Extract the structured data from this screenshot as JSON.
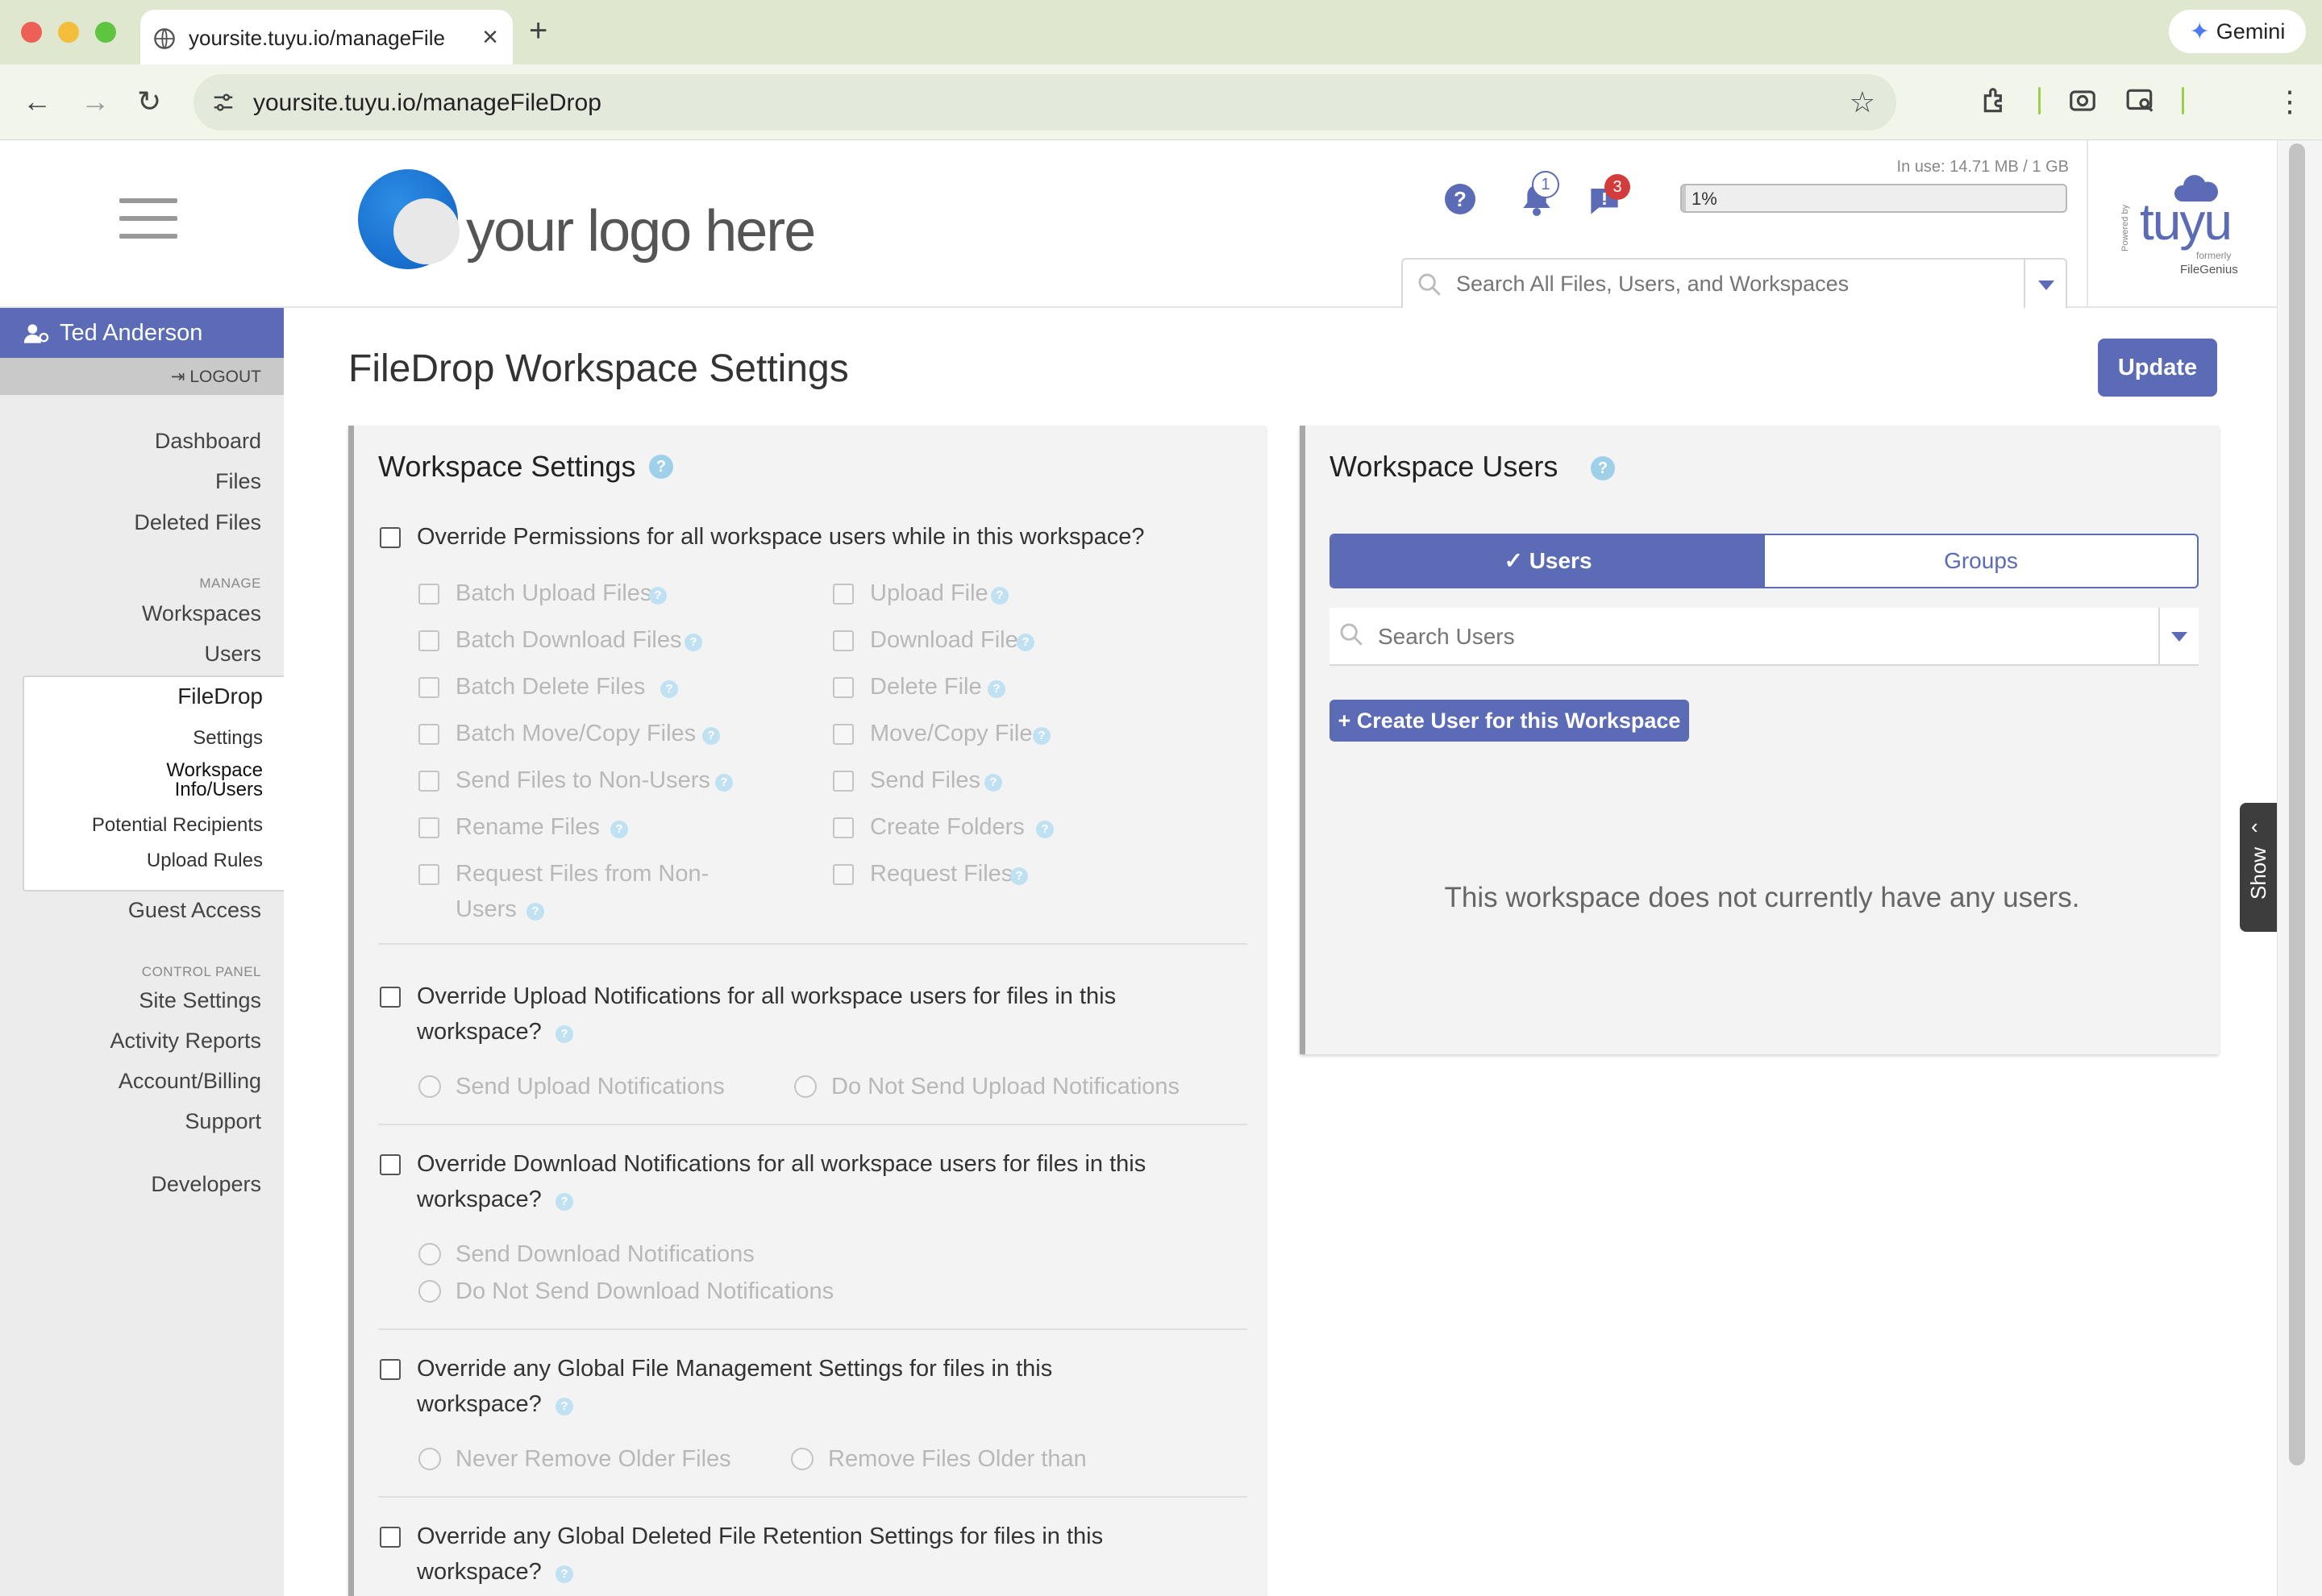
{
  "browser": {
    "tab_title": "yoursite.tuyu.io/manageFileDrop",
    "tab_close": "×",
    "new_tab": "+",
    "url": "yoursite.tuyu.io/manageFileDrop",
    "gemini_label": "Gemini",
    "back": "←",
    "forward": "→",
    "reload": "↻",
    "star": "☆",
    "menu": "⋮"
  },
  "header": {
    "logo_text": "your logo here",
    "help_badge": "?",
    "notifications_count": "1",
    "messages_count": "3",
    "usage_text": "In use: 14.71 MB / 1 GB",
    "usage_percent_label": "1%",
    "usage_fraction": 0.01,
    "search_placeholder": "Search All Files, Users, and Workspaces",
    "brand_powered": "Powered by",
    "brand_name": "tuyu",
    "brand_formerly": "formerly",
    "brand_former_name": "FileGenius"
  },
  "sidebar": {
    "user_name": "Ted Anderson",
    "logout": "LOGOUT",
    "items_top": [
      "Dashboard",
      "Files",
      "Deleted Files"
    ],
    "manage_label": "MANAGE",
    "manage_items": [
      "Workspaces",
      "Users"
    ],
    "filedrop": {
      "title": "FileDrop",
      "settings": "Settings",
      "workspace_info_1": "Workspace",
      "workspace_info_2": "Info/Users",
      "potential_recipients": "Potential Recipients",
      "upload_rules": "Upload Rules"
    },
    "guest_access": "Guest Access",
    "control_panel_label": "CONTROL PANEL",
    "control_items": [
      "Site Settings",
      "Activity Reports",
      "Account/Billing",
      "Support"
    ],
    "developers": "Developers"
  },
  "main": {
    "page_title": "FileDrop Workspace Settings",
    "update_button": "Update",
    "workspace_settings": {
      "title": "Workspace Settings",
      "override_permissions": "Override Permissions for all workspace users while in this workspace?",
      "permissions_left": [
        "Batch Upload Files",
        "Batch Download Files",
        "Batch Delete Files",
        "Batch Move/Copy Files",
        "Send Files to Non-Users",
        "Rename Files",
        "Request Files from Non-",
        "Users"
      ],
      "permissions_right": [
        "Upload File",
        "Download File",
        "Delete File",
        "Move/Copy File",
        "Send Files",
        "Create Folders",
        "Request Files"
      ],
      "upload_notif_1": "Override Upload Notifications for all workspace users for files in this",
      "upload_notif_2": "workspace?",
      "send_upload": "Send Upload Notifications",
      "no_send_upload": "Do Not Send Upload Notifications",
      "download_notif_1": "Override Download Notifications for all workspace users for files in this",
      "download_notif_2": "workspace?",
      "send_download": "Send Download Notifications",
      "no_send_download": "Do Not Send Download Notifications",
      "file_mgmt_1": "Override any Global File Management Settings for files in this",
      "file_mgmt_2": "workspace?",
      "never_remove": "Never Remove Older Files",
      "remove_older": "Remove Files Older than",
      "deleted_retention_1": "Override any Global Deleted File Retention Settings for files in this",
      "deleted_retention_2": "workspace?"
    },
    "workspace_users": {
      "title": "Workspace Users",
      "tab_users": "✓ Users",
      "tab_groups": "Groups",
      "search_placeholder": "Search Users",
      "create_button": "+ Create User for this Workspace",
      "empty_message": "This workspace does not currently have any users."
    }
  },
  "show_panel": {
    "chevron": "‹",
    "label": "Show"
  },
  "colors": {
    "accent": "#5b6bb5",
    "badge_red": "#d23c3c",
    "help_blue": "#9fd0ea"
  }
}
